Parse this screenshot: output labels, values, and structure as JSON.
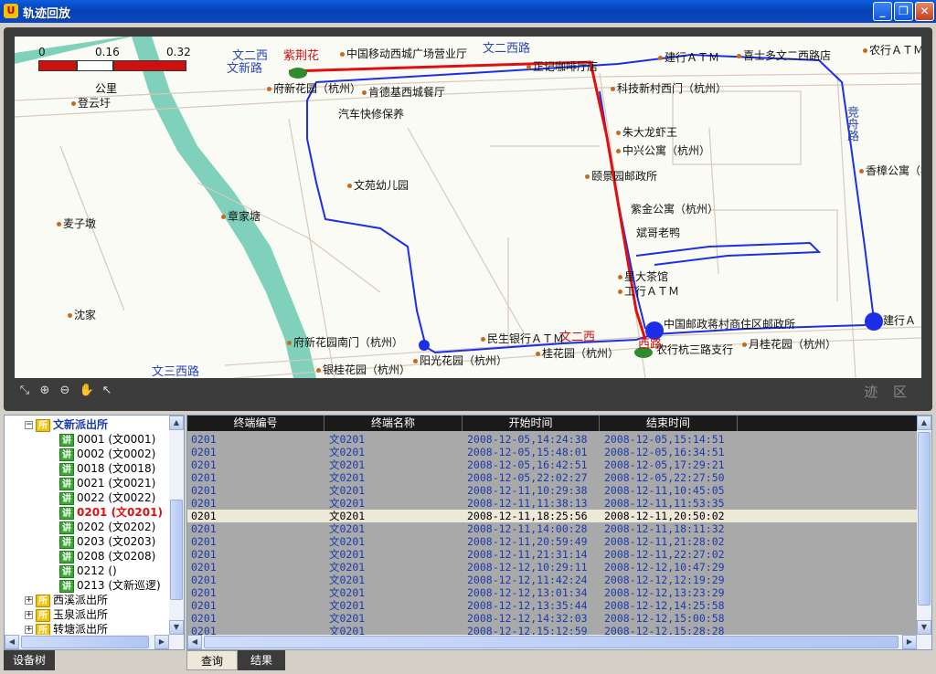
{
  "window": {
    "title": "轨迹回放",
    "icon_text": "U"
  },
  "map": {
    "scale": {
      "ticks": [
        "0",
        "0.16",
        "0.32"
      ],
      "unit": "公里"
    },
    "watermark": "迹 区",
    "roads": [
      {
        "text": "文二西",
        "red": false
      },
      {
        "text": "紫荆花",
        "red": true
      },
      {
        "text": "文新路",
        "red": false
      },
      {
        "text": "文二西路",
        "red": false
      },
      {
        "text": "文三西路",
        "red": false
      },
      {
        "text": "竞舟路",
        "red": false
      },
      {
        "text": "文二西",
        "red": true
      },
      {
        "text": "西路",
        "red": true
      }
    ],
    "pois": [
      "中国移动西城广场营业厅",
      "正记咖啡厅",
      "店",
      "建行ＡＴＭ",
      "喜士多文二西路店",
      "农行ＡＴＭ",
      "登云圩",
      "府新花园（杭州）",
      "肯德基西城餐厅",
      "汽车快修保养",
      "科技新村西门（杭州）",
      "朱大龙虾王",
      "中兴公寓（杭州）",
      "香樟公寓（杭州）",
      "颐景园邮政所",
      "文苑幼儿园",
      "麦子墩",
      "章家塘",
      "紫金公寓（杭州）",
      "斌哥老鸭",
      "星大茶馆",
      "工行ＡＴＭ",
      "中国邮政蒋村商住区邮政所",
      "建行Ａ",
      "沈家",
      "府新花园南门（杭州）",
      "民生银行ＡＴＭ",
      "农行杭三路支行",
      "月桂花园（杭州）",
      "阳光花园（杭州）",
      "桂花园（杭州）",
      "银桂花园（杭州）"
    ]
  },
  "tree": {
    "root": "文新派出所",
    "items": [
      {
        "label": "0001 (文0001)",
        "selected": false
      },
      {
        "label": "0002 (文0002)",
        "selected": false
      },
      {
        "label": "0018 (文0018)",
        "selected": false
      },
      {
        "label": "0021 (文0021)",
        "selected": false
      },
      {
        "label": "0022 (文0022)",
        "selected": false
      },
      {
        "label": "0201 (文0201)",
        "selected": true
      },
      {
        "label": "0202 (文0202)",
        "selected": false
      },
      {
        "label": "0203 (文0203)",
        "selected": false
      },
      {
        "label": "0208 (文0208)",
        "selected": false
      },
      {
        "label": "0212 ()",
        "selected": false
      },
      {
        "label": "0213 (文新巡逻)",
        "selected": false
      }
    ],
    "siblings": [
      "西溪派出所",
      "玉泉派出所",
      "转塘派出所"
    ],
    "icon_suo": "所",
    "icon_jiang": "讲"
  },
  "grid": {
    "columns": [
      "终端编号",
      "终端名称",
      "开始时间",
      "结束时间"
    ],
    "selected_index": 6,
    "rows": [
      [
        "0201",
        "文0201",
        "2008-12-05,14:24:38",
        "2008-12-05,15:14:51"
      ],
      [
        "0201",
        "文0201",
        "2008-12-05,15:48:01",
        "2008-12-05,16:34:51"
      ],
      [
        "0201",
        "文0201",
        "2008-12-05,16:42:51",
        "2008-12-05,17:29:21"
      ],
      [
        "0201",
        "文0201",
        "2008-12-05,22:02:27",
        "2008-12-05,22:27:50"
      ],
      [
        "0201",
        "文0201",
        "2008-12-11,10:29:38",
        "2008-12-11,10:45:05"
      ],
      [
        "0201",
        "文0201",
        "2008-12-11,11:38:13",
        "2008-12-11,11:53:35"
      ],
      [
        "0201",
        "文0201",
        "2008-12-11,18:25:56",
        "2008-12-11,20:50:02"
      ],
      [
        "0201",
        "文0201",
        "2008-12-11,14:00:28",
        "2008-12-11,18:11:32"
      ],
      [
        "0201",
        "文0201",
        "2008-12-11,20:59:49",
        "2008-12-11,21:28:02"
      ],
      [
        "0201",
        "文0201",
        "2008-12-11,21:31:14",
        "2008-12-11,22:27:02"
      ],
      [
        "0201",
        "文0201",
        "2008-12-12,10:29:11",
        "2008-12-12,10:47:29"
      ],
      [
        "0201",
        "文0201",
        "2008-12-12,11:42:24",
        "2008-12-12,12:19:29"
      ],
      [
        "0201",
        "文0201",
        "2008-12-12,13:01:34",
        "2008-12-12,13:23:29"
      ],
      [
        "0201",
        "文0201",
        "2008-12-12,13:35:44",
        "2008-12-12,14:25:58"
      ],
      [
        "0201",
        "文0201",
        "2008-12-12,14:32:03",
        "2008-12-12,15:00:58"
      ],
      [
        "0201",
        "文0201",
        "2008-12-12,15:12:59",
        "2008-12-12,15:28:28"
      ]
    ]
  },
  "tabs": {
    "left": "设备树",
    "query": "查询",
    "result": "结果"
  }
}
